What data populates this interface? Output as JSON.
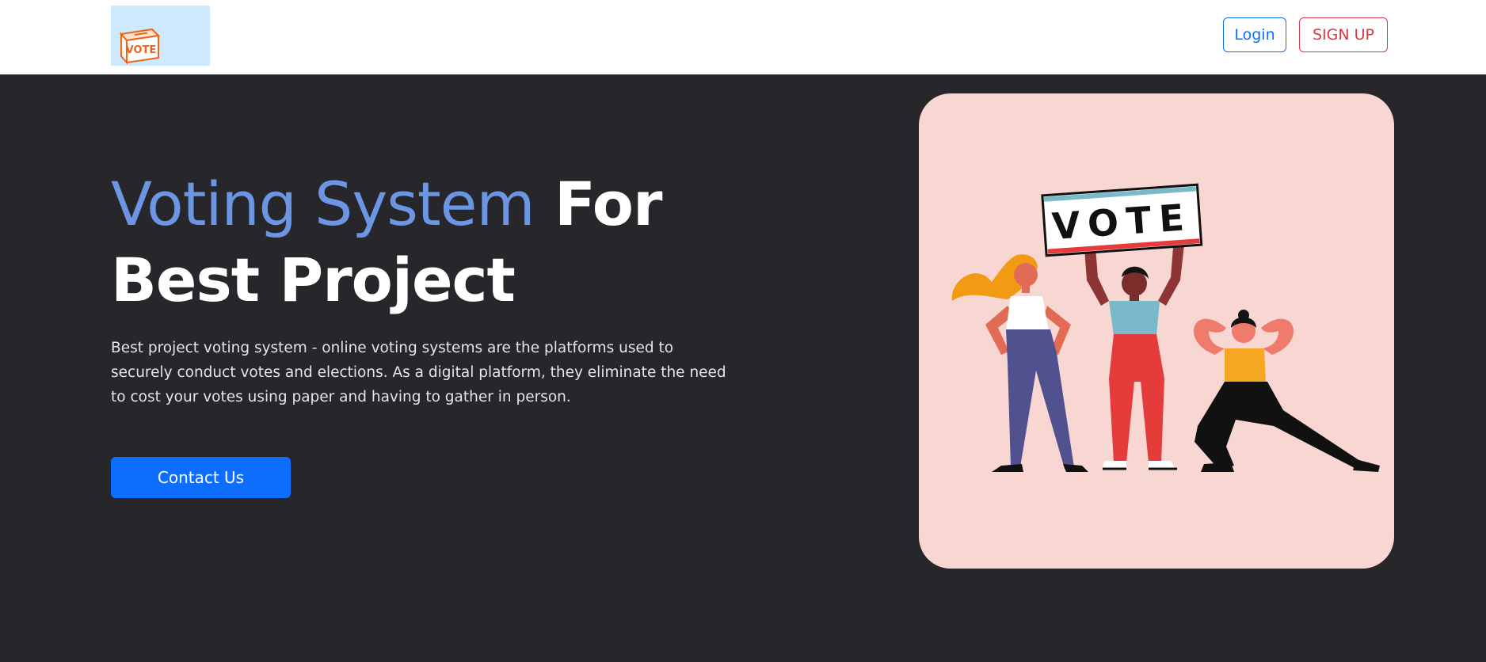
{
  "navbar": {
    "logo_text": "VOTE",
    "login_label": "Login",
    "signup_label": "SIGN UP"
  },
  "hero": {
    "title_accent": "Voting System",
    "title_rest": "For Best Project",
    "description": "Best project voting system - online voting systems are the platforms used to securely conduct votes and elections. As a digital platform, they eliminate the need to cost your votes using paper and having to gather in person.",
    "cta_label": "Contact Us",
    "illustration": {
      "sign_text": "VOTE",
      "icon": "people-holding-vote-sign-illustration"
    }
  },
  "colors": {
    "page_background": "#27272b",
    "navbar_background": "#ffffff",
    "accent_title": "#6c96e4",
    "primary": "#0d6efd",
    "danger": "#dc3545",
    "card_background": "#f8d7d3",
    "logo_background": "#cde9fb"
  }
}
